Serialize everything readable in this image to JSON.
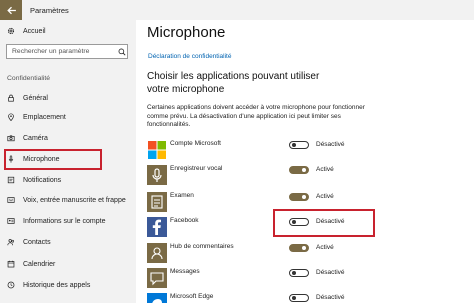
{
  "window": {
    "title": "Paramètres",
    "accent": "#7a6a45"
  },
  "sidebar": {
    "home_label": "Accueil",
    "search_placeholder": "Rechercher un paramètre",
    "section_label": "Confidentialité",
    "items": [
      {
        "label": "Général",
        "icon": "lock-icon"
      },
      {
        "label": "Emplacement",
        "icon": "location-icon"
      },
      {
        "label": "Caméra",
        "icon": "camera-icon"
      },
      {
        "label": "Microphone",
        "icon": "microphone-icon",
        "selected": true
      },
      {
        "label": "Notifications",
        "icon": "notification-icon"
      },
      {
        "label": "Voix, entrée manuscrite et frappe",
        "icon": "pen-icon"
      },
      {
        "label": "Informations sur le compte",
        "icon": "account-icon"
      },
      {
        "label": "Contacts",
        "icon": "contacts-icon"
      },
      {
        "label": "Calendrier",
        "icon": "calendar-icon"
      },
      {
        "label": "Historique des appels",
        "icon": "call-history-icon"
      }
    ]
  },
  "main": {
    "title": "Microphone",
    "privacy_link": "Déclaration de confidentialité",
    "heading": "Choisir les applications pouvant utiliser votre microphone",
    "description": "Certaines applications doivent accéder à votre microphone pour fonctionner comme prévu. La désactivation d'une application ici peut limiter ses fonctionnalités.",
    "apps": [
      {
        "name": "Compte Microsoft",
        "state": "Désactivé",
        "on": false,
        "icon": "microsoft-icon"
      },
      {
        "name": "Enregistreur vocal",
        "state": "Activé",
        "on": true,
        "icon": "voice-recorder-icon"
      },
      {
        "name": "Examen",
        "state": "Activé",
        "on": true,
        "icon": "exam-icon"
      },
      {
        "name": "Facebook",
        "state": "Désactivé",
        "on": false,
        "icon": "facebook-icon"
      },
      {
        "name": "Hub de commentaires",
        "state": "Activé",
        "on": true,
        "icon": "feedback-hub-icon"
      },
      {
        "name": "Messages",
        "state": "Désactivé",
        "on": false,
        "icon": "messages-icon"
      },
      {
        "name": "Microsoft Edge",
        "state": "Désactivé",
        "on": false,
        "icon": "edge-icon"
      }
    ]
  },
  "annotation_color": "#c8222e"
}
